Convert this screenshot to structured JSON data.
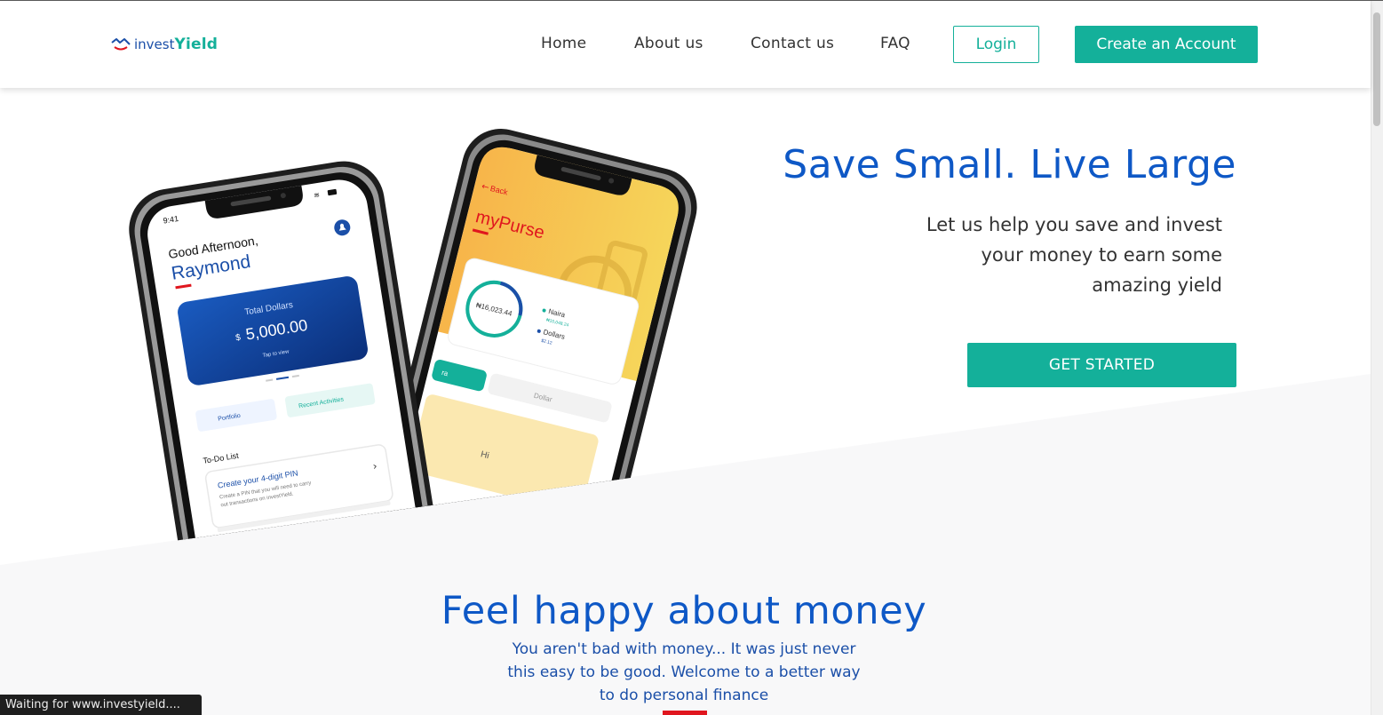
{
  "header": {
    "logo": {
      "part1": "invest",
      "part2": "Yield"
    },
    "nav": [
      {
        "label": "Home"
      },
      {
        "label": "About us"
      },
      {
        "label": "Contact us"
      },
      {
        "label": "FAQ"
      }
    ],
    "login_label": "Login",
    "create_label": "Create an Account"
  },
  "hero": {
    "title": "Save Small. Live Large",
    "subtitle": "Let us help you save and invest your money to earn some amazing yield",
    "cta_label": "GET STARTED"
  },
  "phone_front": {
    "time": "9:41",
    "greeting": "Good Afternoon,",
    "name": "Raymond",
    "card_label": "Total Dollars",
    "card_currency": "$",
    "card_amount": "5,000.00",
    "card_hint": "Tap to view",
    "tab1": "Portfolio",
    "tab2": "Recent Activities",
    "todo_title": "To-Do List",
    "todo_item_title": "Create your 4-digit PIN",
    "todo_item_desc1": "Create a PIN that you will need to carry",
    "todo_item_desc2": "out transactions on investYield."
  },
  "phone_back": {
    "back_label": "Back",
    "title": "myPurse",
    "total": "₦16,023.44",
    "legend1": "Naira",
    "legend1_value": "₦10,048.24",
    "legend2": "Dollars",
    "legend2_value": "$2.12",
    "tab1": "ra",
    "tab2": "Dollar",
    "bottom_text": "Hi"
  },
  "section2": {
    "title": "Feel happy about money",
    "text": "You aren't bad with money... It was just never this easy to be good. Welcome to a better way to do personal finance"
  },
  "status_text": "Waiting for www.investyield....",
  "colors": {
    "brand_blue": "#0e58c6",
    "brand_teal": "#14b09a",
    "accent_red": "#e0161e"
  }
}
